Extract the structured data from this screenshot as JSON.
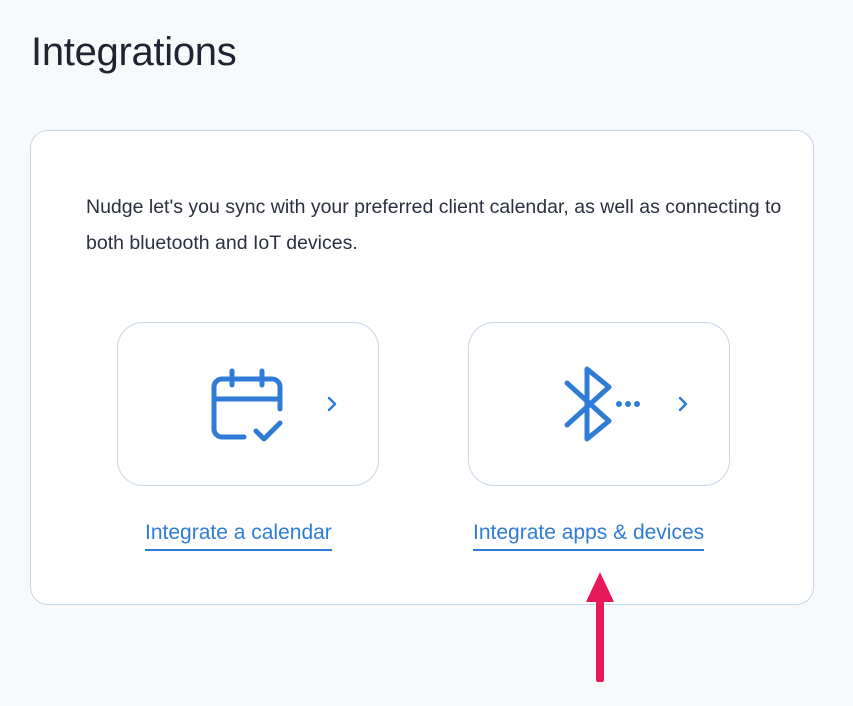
{
  "page": {
    "title": "Integrations"
  },
  "panel": {
    "description": "Nudge let's you sync with your preferred client calendar, as well as connecting to both bluetooth and IoT devices."
  },
  "options": {
    "calendar": {
      "icon": "calendar-check-icon",
      "link_label": "Integrate a calendar"
    },
    "devices": {
      "icon": "bluetooth-icon",
      "link_label": "Integrate apps & devices"
    }
  },
  "colors": {
    "accent": "#2f7cd6",
    "border": "#c6d6ea",
    "annotation_arrow": "#e8195a",
    "background": "#f8f9fb"
  }
}
